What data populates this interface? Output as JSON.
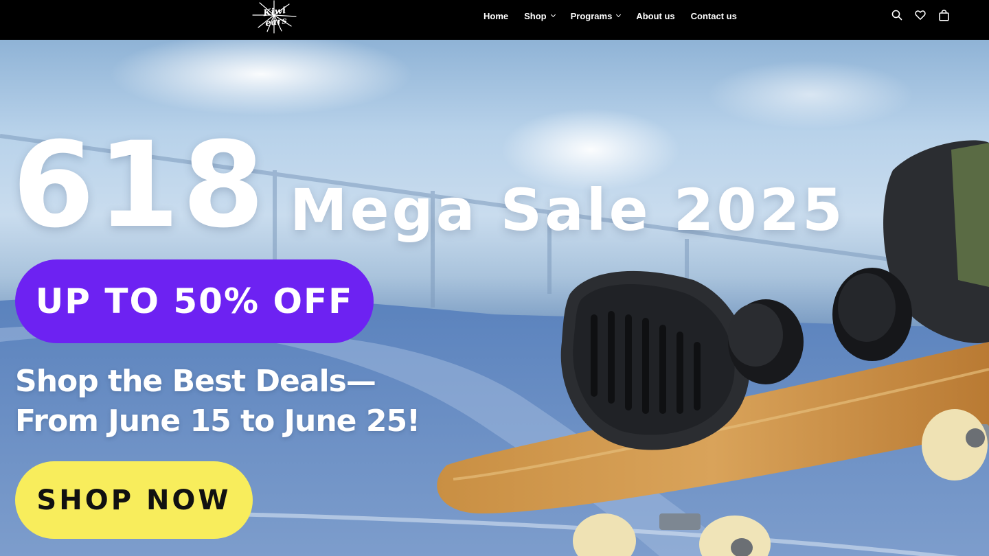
{
  "header": {
    "logo_text": "Kiwi ears",
    "nav": [
      {
        "label": "Home"
      },
      {
        "label": "Shop"
      },
      {
        "label": "Programs"
      },
      {
        "label": "About us"
      },
      {
        "label": "Contact us"
      }
    ],
    "icons": [
      "search-icon",
      "heart-icon",
      "shopping-bag-icon"
    ]
  },
  "hero": {
    "title_number": "618",
    "title_text": "Mega Sale 2025",
    "discount": "UP TO 50% OFF",
    "deal_line_1": "Shop the Best Deals—",
    "deal_line_2": "From June 15 to June 25!",
    "cta_label": "SHOP NOW"
  },
  "colors": {
    "header_bg": "#000000",
    "discount_pill": "#6d22f2",
    "cta_bg": "#f8ed5c",
    "cta_text": "#111111"
  }
}
